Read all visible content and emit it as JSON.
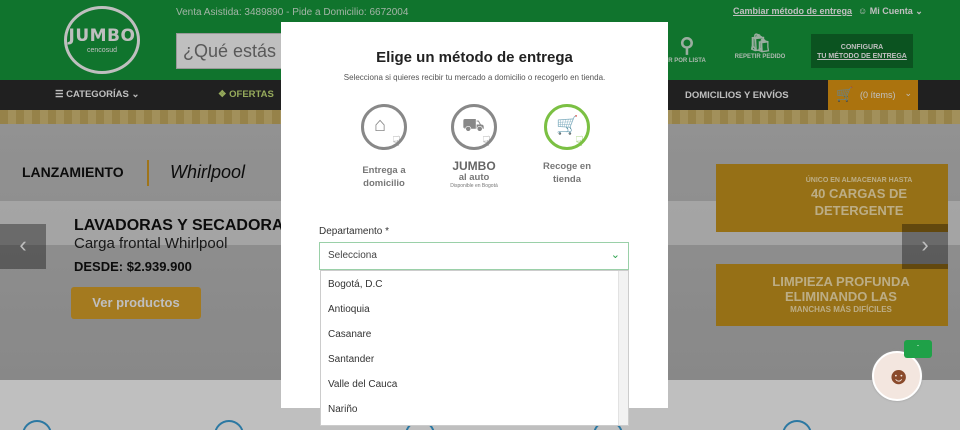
{
  "header": {
    "logo": "JUMBO",
    "logo_sub": "cencosud",
    "top_info": "Venta Asistida: 3489890  -  Pide a Domicilio: 6672004",
    "change_link": "Cambiar método de entrega",
    "account": "Mi Cuenta",
    "search_placeholder": "¿Qué estás b",
    "list_label": "R POR LISTA",
    "repeat_label": "REPETIR PEDIDO",
    "config_line1": "CONFIGURA",
    "config_line2": "TU MÉTODO DE ENTREGA"
  },
  "nav": {
    "categories": "CATEGORÍAS",
    "offers": "OFERTAS",
    "deliveries": "DOMICILIOS Y ENVÍOS",
    "cart": "(0 ítems)"
  },
  "banner": {
    "launch": "LANZAMIENTO",
    "brand": "Whirlpool",
    "title1": "LAVADORAS Y SECADORAS",
    "title2": "Carga frontal Whirlpool",
    "price": "DESDE: $2.939.900",
    "cta": "Ver productos",
    "promo1a": "ÚNICO EN ALMACENAR HASTA",
    "promo1b": "40 CARGAS DE",
    "promo1c": "DETERGENTE",
    "promo2a": "LIMPIEZA PROFUNDA",
    "promo2b": "ELIMINANDO LAS",
    "promo2c": "MANCHAS MÁS DIFÍCILES"
  },
  "modal": {
    "title": "Elige un método de entrega",
    "subtitle": "Selecciona si quieres recibir tu mercado a domicilio o recogerlo en tienda.",
    "opt1_l1": "Entrega a",
    "opt1_l2": "domicilio",
    "opt2_logo": "JUMBO",
    "opt2_l1": "al auto",
    "opt2_note": "Disponible en Bogotá",
    "opt3_l1": "Recoge en",
    "opt3_l2": "tienda",
    "dept_label": "Departamento *",
    "select_value": "Selecciona",
    "options": [
      "Bogotá, D.C",
      "Antioquia",
      "Casanare",
      "Santander",
      "Valle del Cauca",
      "Nariño"
    ]
  },
  "colors": {
    "brand_green": "#169B3C",
    "accent_orange": "#E59A13",
    "option_active": "#7BC043"
  }
}
